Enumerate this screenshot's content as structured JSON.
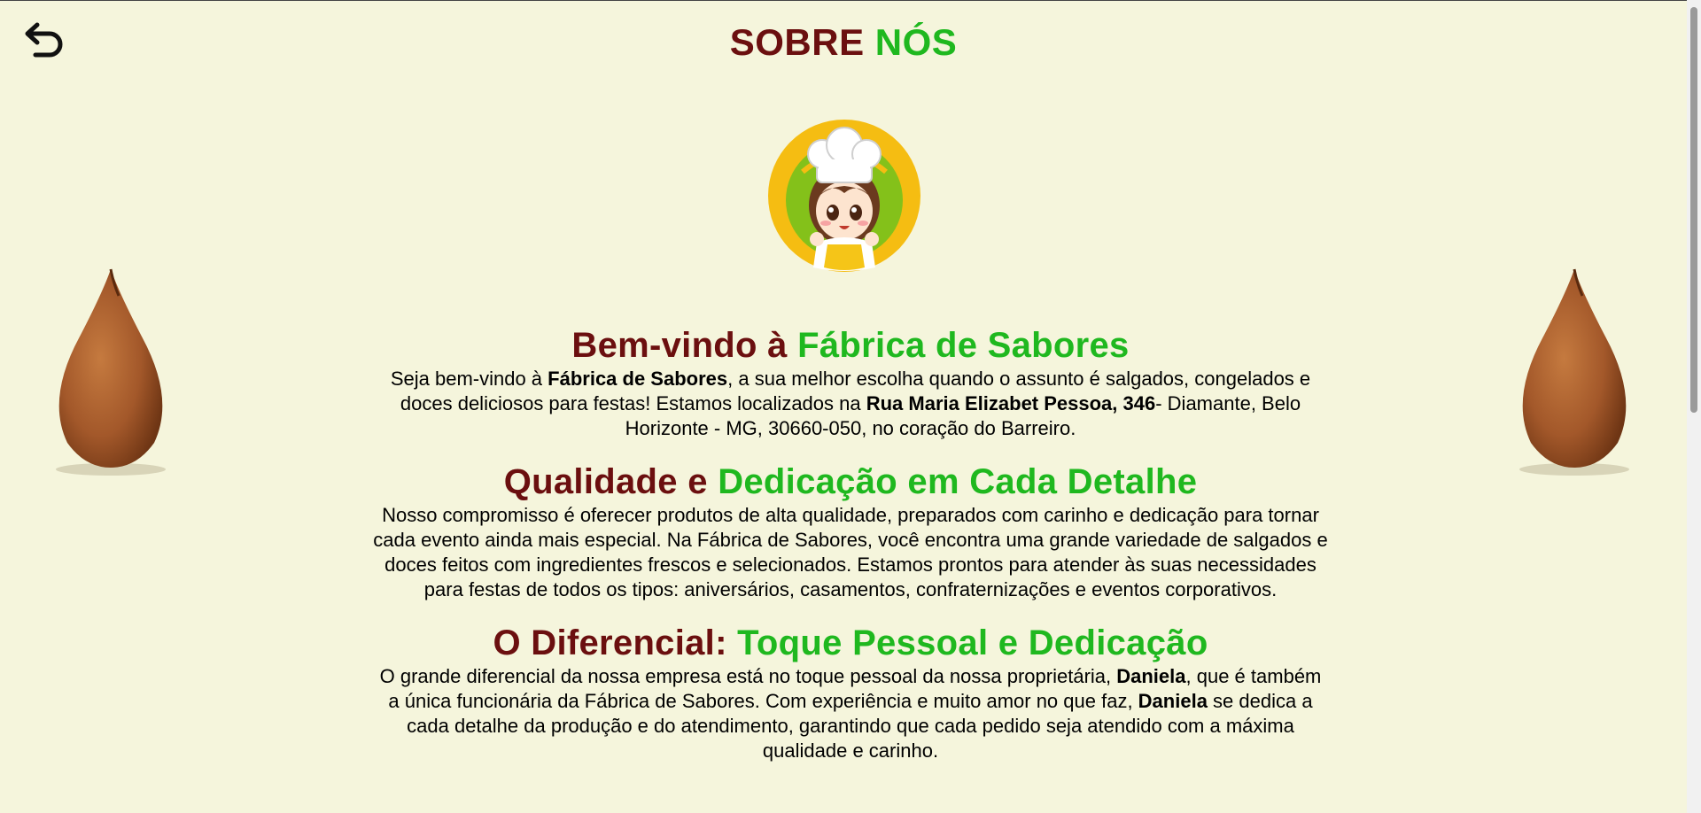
{
  "header": {
    "title_part1": "SOBRE",
    "title_part2": "NÓS",
    "back_icon": "undo-arrow-icon"
  },
  "logo": {
    "icon": "chef-girl-logo"
  },
  "decor": {
    "left": "coxinha-image",
    "right": "coxinha-image"
  },
  "sections": [
    {
      "heading_part1": "Bem-vindo à",
      "heading_part2": "Fábrica de Sabores",
      "text": {
        "p1": "Seja bem-vindo à ",
        "b1": "Fábrica de Sabores",
        "p2": ", a sua melhor escolha quando o assunto é salgados, congelados e doces deliciosos para festas! Estamos localizados na ",
        "b2": "Rua Maria Elizabet Pessoa, 346",
        "p3": "- Diamante, Belo Horizonte - MG, 30660-050, no coração do Barreiro."
      }
    },
    {
      "heading_part1": "Qualidade e",
      "heading_part2": "Dedicação em Cada Detalhe",
      "text": {
        "p1": "Nosso compromisso é oferecer produtos de alta qualidade, preparados com carinho e dedicação para tornar cada evento ainda mais especial. Na Fábrica de Sabores, você encontra uma grande variedade de salgados e doces feitos com ingredientes frescos e selecionados. Estamos prontos para atender às suas necessidades para festas de todos os tipos: aniversários, casamentos, confraternizações e eventos corporativos."
      }
    },
    {
      "heading_part1": "O Diferencial:",
      "heading_part2": "Toque Pessoal e Dedicação",
      "text": {
        "p1": "O grande diferencial da nossa empresa está no toque pessoal da nossa proprietária, ",
        "b1": "Daniela",
        "p2": ", que é também a única funcionária da Fábrica de Sabores. Com experiência e muito amor no que faz, ",
        "b2": "Daniela",
        "p3": " se dedica a cada detalhe da produção e do atendimento, garantindo que cada pedido seja atendido com a máxima qualidade e carinho."
      }
    }
  ],
  "colors": {
    "background": "#f5f5dc",
    "maroon": "#6b0f0f",
    "green": "#1fb81f"
  }
}
